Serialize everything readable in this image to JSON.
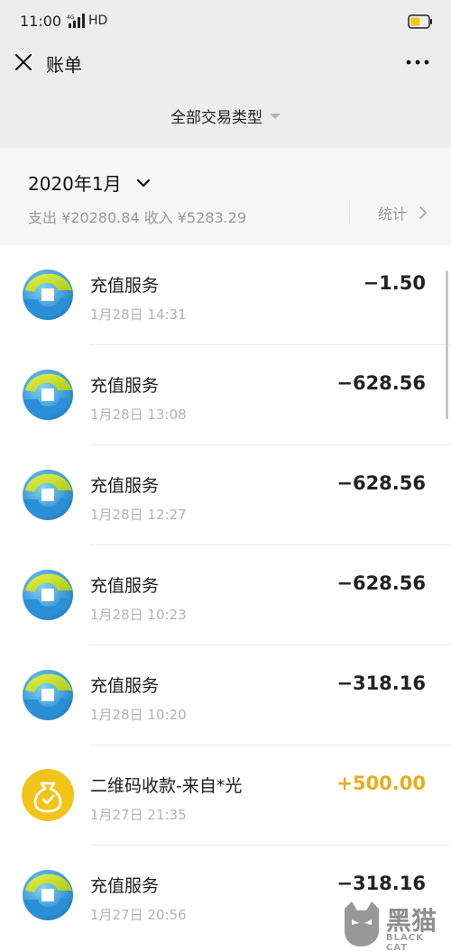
{
  "status_bar": {
    "time": "11:00",
    "network": "HD",
    "icons": [
      "signal-4g-icon",
      "battery-icon"
    ]
  },
  "header": {
    "title": "账单",
    "close_icon": "close-icon",
    "more_icon": "more-dots-icon"
  },
  "filter": {
    "label": "全部交易类型"
  },
  "summary": {
    "month": "2020年1月",
    "totals": "支出 ¥20280.84 收入 ¥5283.29",
    "stats_label": "统计"
  },
  "transactions": [
    {
      "title": "充值服务",
      "time": "1月28日 14:31",
      "amount": "−1.50",
      "type": "expense",
      "icon": "recharge-service-logo"
    },
    {
      "title": "充值服务",
      "time": "1月28日 13:08",
      "amount": "−628.56",
      "type": "expense",
      "icon": "recharge-service-logo"
    },
    {
      "title": "充值服务",
      "time": "1月28日 12:27",
      "amount": "−628.56",
      "type": "expense",
      "icon": "recharge-service-logo"
    },
    {
      "title": "充值服务",
      "time": "1月28日 10:23",
      "amount": "−628.56",
      "type": "expense",
      "icon": "recharge-service-logo"
    },
    {
      "title": "充值服务",
      "time": "1月28日 10:20",
      "amount": "−318.16",
      "type": "expense",
      "icon": "recharge-service-logo"
    },
    {
      "title": "二维码收款-来自*光",
      "time": "1月27日 21:35",
      "amount": "+500.00",
      "type": "income",
      "icon": "qr-payment-money-bag-icon"
    },
    {
      "title": "充值服务",
      "time": "1月27日 20:56",
      "amount": "−318.16",
      "type": "expense",
      "icon": "recharge-service-logo"
    }
  ],
  "colors": {
    "income": "#e6ad1b",
    "expense": "#222222",
    "header_bg": "#ededed",
    "summary_bg": "#f6f6f6"
  },
  "watermark": {
    "text": "黑猫",
    "subtext": "BLACK CAT"
  }
}
